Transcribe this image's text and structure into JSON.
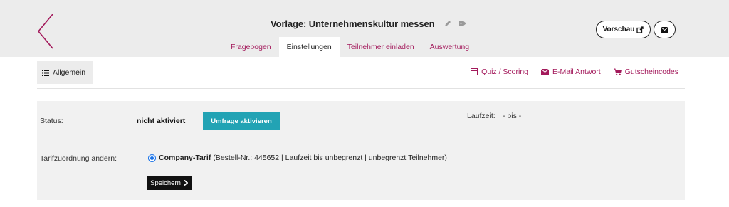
{
  "header": {
    "title": "Vorlage: Unternehmenskultur messen",
    "preview_label": "Vorschau",
    "colors": {
      "accent": "#a3195b",
      "header_bg": "#ececec",
      "primary_button": "#22a3b4"
    }
  },
  "tabs": [
    {
      "label": "Fragebogen",
      "active": false
    },
    {
      "label": "Einstellungen",
      "active": true
    },
    {
      "label": "Teilnehmer einladen",
      "active": false
    },
    {
      "label": "Auswertung",
      "active": false
    }
  ],
  "subnav": {
    "general_label": "Allgemein",
    "links": [
      {
        "label": "Quiz / Scoring",
        "icon": "table-icon"
      },
      {
        "label": "E-Mail Antwort",
        "icon": "envelope-icon"
      },
      {
        "label": "Gutscheincodes",
        "icon": "cart-icon"
      }
    ]
  },
  "settings": {
    "status_label": "Status:",
    "status_value": "nicht aktiviert",
    "activate_label": "Umfrage aktivieren",
    "runtime_label": "Laufzeit:",
    "runtime_value": "- bis -",
    "tariff_label": "Tarifzuordnung ändern:",
    "tariff_name": "Company-Tarif",
    "tariff_details": "(Bestell-Nr.: 445652 | Laufzeit bis unbegrenzt | unbegrenzt Teilnehmer)",
    "save_label": "Speichern"
  }
}
